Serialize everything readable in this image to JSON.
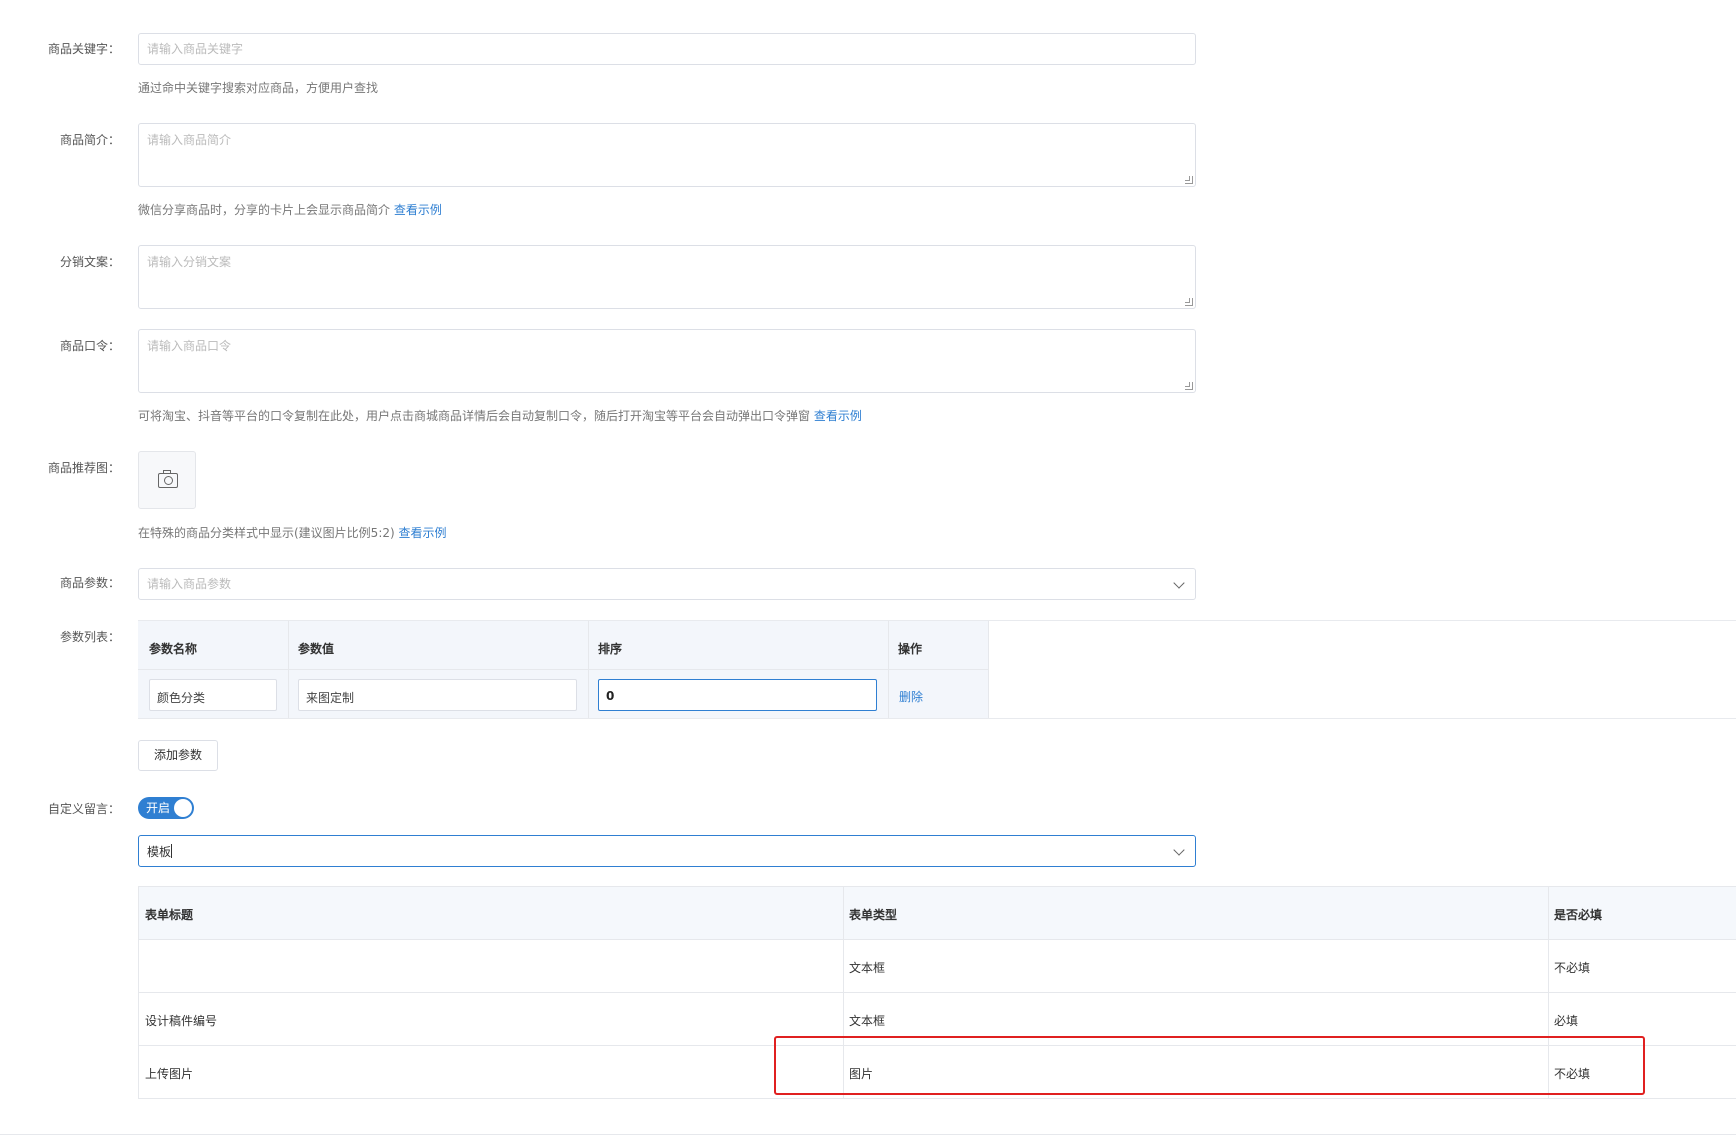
{
  "keyword": {
    "label": "商品关键字：",
    "placeholder": "请输入商品关键字",
    "help": "通过命中关键字搜索对应商品，方便用户查找"
  },
  "intro": {
    "label": "商品简介：",
    "placeholder": "请输入商品简介",
    "help": "微信分享商品时，分享的卡片上会显示商品简介",
    "example_link": "查看示例"
  },
  "distribution": {
    "label": "分销文案：",
    "placeholder": "请输入分销文案"
  },
  "password": {
    "label": "商品口令：",
    "placeholder": "请输入商品口令",
    "help": "可将淘宝、抖音等平台的口令复制在此处，用户点击商城商品详情后会自动复制口令，随后打开淘宝等平台会自动弹出口令弹窗",
    "example_link": "查看示例"
  },
  "recommend_image": {
    "label": "商品推荐图：",
    "help": "在特殊的商品分类样式中显示(建议图片比例5:2)",
    "example_link": "查看示例"
  },
  "params": {
    "label": "商品参数：",
    "placeholder": "请输入商品参数"
  },
  "param_list": {
    "label": "参数列表：",
    "headers": [
      "参数名称",
      "参数值",
      "排序",
      "操作"
    ],
    "row": {
      "name": "颜色分类",
      "value": "来图定制",
      "sort": "0",
      "action": "删除"
    },
    "add_button": "添加参数"
  },
  "custom_message": {
    "label": "自定义留言：",
    "toggle_text": "开启",
    "template_value": "模板",
    "table": {
      "headers": [
        "表单标题",
        "表单类型",
        "是否必填"
      ],
      "rows": [
        {
          "title": "",
          "type": "文本框",
          "required": "不必填"
        },
        {
          "title": "设计稿件编号",
          "type": "文本框",
          "required": "必填"
        },
        {
          "title": "上传图片",
          "type": "图片",
          "required": "不必填"
        }
      ]
    }
  }
}
